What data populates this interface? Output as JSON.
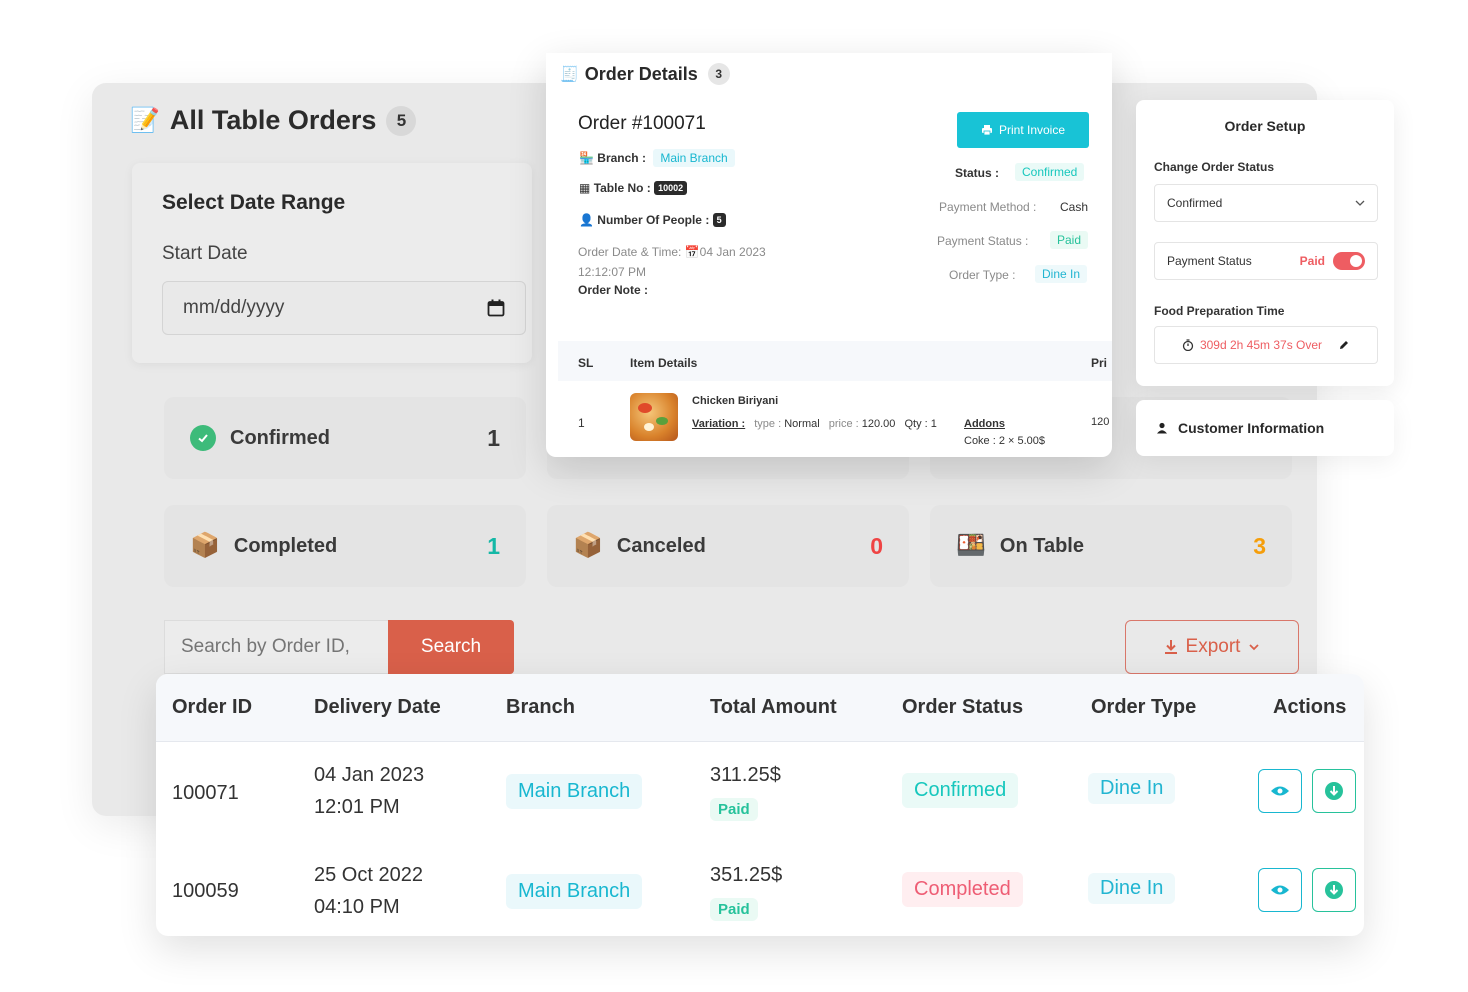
{
  "all_orders": {
    "title": "All Table Orders",
    "count": "5",
    "date_range": {
      "heading": "Select Date Range",
      "start_label": "Start Date",
      "start_placeholder": "mm/dd/yyyy"
    },
    "stats": [
      {
        "label": "Confirmed",
        "value": "1",
        "color": "#3a3a3a"
      },
      {
        "label": "Completed",
        "value": "1",
        "color": "#14b8a6"
      },
      {
        "label": "Canceled",
        "value": "0",
        "color": "#ef4444"
      },
      {
        "label": "On Table",
        "value": "3",
        "color": "#f59e0b"
      }
    ],
    "search_placeholder": "Search by Order ID,",
    "search_button": "Search",
    "export_button": "Export"
  },
  "orders_table": {
    "headers": [
      "Order ID",
      "Delivery Date",
      "Branch",
      "Total Amount",
      "Order Status",
      "Order Type",
      "Actions"
    ],
    "rows": [
      {
        "id": "100071",
        "date": "04 Jan 2023",
        "time": "12:01 PM",
        "branch": "Main Branch",
        "amount": "311.25$",
        "payment": "Paid",
        "status": "Confirmed",
        "type": "Dine In"
      },
      {
        "id": "100059",
        "date": "25 Oct 2022",
        "time": "04:10 PM",
        "branch": "Main Branch",
        "amount": "351.25$",
        "payment": "Paid",
        "status": "Completed",
        "type": "Dine In"
      }
    ]
  },
  "order_details": {
    "title": "Order Details",
    "count": "3",
    "order_number": "Order #100071",
    "branch_label": "Branch :",
    "branch_value": "Main Branch",
    "table_label": "Table No :",
    "table_value": "10002",
    "people_label": "Number Of People :",
    "people_value": "5",
    "datetime_label": "Order Date & Time:",
    "datetime_date": "04 Jan 2023",
    "datetime_time": "12:12:07 PM",
    "note_label": "Order Note :",
    "print_button": "Print Invoice",
    "status_label": "Status :",
    "status_value": "Confirmed",
    "payment_method_label": "Payment Method :",
    "payment_method_value": "Cash",
    "payment_status_label": "Payment Status :",
    "payment_status_value": "Paid",
    "order_type_label": "Order Type :",
    "order_type_value": "Dine In",
    "items_headers": {
      "sl": "SL",
      "details": "Item Details",
      "price": "Pri"
    },
    "item": {
      "sl": "1",
      "name": "Chicken Biriyani",
      "variation_label": "Variation :",
      "type_label": "type :",
      "type_value": "Normal",
      "price_label": "price :",
      "price_value": "120.00",
      "qty_label": "Qty :",
      "qty_value": "1",
      "addons_label": "Addons",
      "addon_line": "Coke : 2 × 5.00$",
      "line_price": "120"
    }
  },
  "order_setup": {
    "title": "Order Setup",
    "change_status_label": "Change Order Status",
    "status_value": "Confirmed",
    "payment_status_label": "Payment Status",
    "payment_status_value": "Paid",
    "payment_toggle_on": true,
    "prep_time_label": "Food Preparation Time",
    "prep_time_value": "309d 2h 45m 37s Over"
  },
  "customer": {
    "title": "Customer Information"
  }
}
